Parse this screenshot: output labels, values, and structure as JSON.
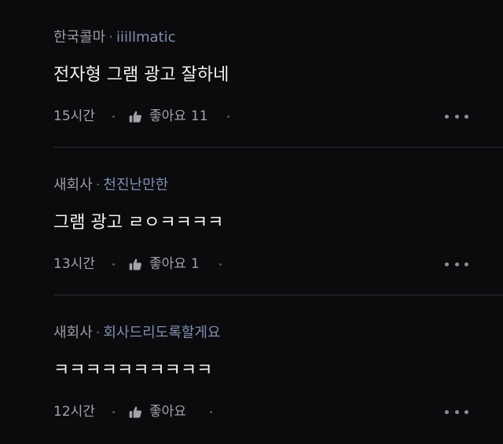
{
  "comments": [
    {
      "company": "한국콜마",
      "separator": "·",
      "nickname": "iiillmatic",
      "content": "전자형 그램 광고 잘하네",
      "time": "15시간",
      "like_label": "좋아요",
      "like_count": "11"
    },
    {
      "company": "새회사",
      "separator": "·",
      "nickname": "천진난만한",
      "content": "그램 광고 ㄹㅇㅋㅋㅋㅋ",
      "time": "13시간",
      "like_label": "좋아요",
      "like_count": "1"
    },
    {
      "company": "새회사",
      "separator": "·",
      "nickname": "회사드리도록할게요",
      "content": "ㅋㅋㅋㅋㅋㅋㅋㅋㅋㅋ",
      "time": "12시간",
      "like_label": "좋아요",
      "like_count": ""
    }
  ],
  "icons": {
    "like": "thumbs-up-icon",
    "more": "more-horizontal-icon"
  },
  "colors": {
    "background": "#0b0b0d",
    "company": "#9a9ca2",
    "nickname": "#7f8eb0",
    "content": "#f2f2f2",
    "meta": "#a2a4a9",
    "divider": "#2a2b2f"
  }
}
